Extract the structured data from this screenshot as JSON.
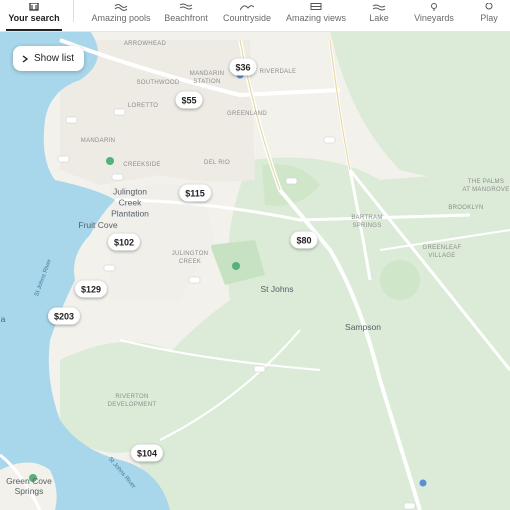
{
  "categories": [
    {
      "label": "Your search",
      "icon": "search-history-icon"
    },
    {
      "label": "Amazing pools",
      "icon": "pool-icon"
    },
    {
      "label": "Beachfront",
      "icon": "waves-icon"
    },
    {
      "label": "Countryside",
      "icon": "hills-icon"
    },
    {
      "label": "Amazing views",
      "icon": "view-icon"
    },
    {
      "label": "Lake",
      "icon": "lake-icon"
    },
    {
      "label": "Vineyards",
      "icon": "grape-icon"
    },
    {
      "label": "Play",
      "icon": "play-icon"
    }
  ],
  "show_list_label": "Show list",
  "price_pins": [
    "$36",
    "$55",
    "$115",
    "$80",
    "$102",
    "$129",
    "$203",
    "$104"
  ],
  "places": {
    "julington": "Julington\nCreek\nPlantation",
    "fruit_cove": "Fruit Cove",
    "st_johns": "St Johns",
    "sampson": "Sampson",
    "green_cove": "Green Cove\nSprings",
    "arrowhead": "ARROWHEAD",
    "southwood": "SOUTHWOOD",
    "loretto": "LORETTO",
    "mandarin_station": "MANDARIN\nSTATION",
    "mandarin": "MANDARIN",
    "creekside": "CREEKSIDE",
    "del_rio": "DEL RIO",
    "greenland": "GREENLAND",
    "bartram": "BARTRAM\nSPRINGS",
    "julington_creek": "JULINGTON\nCREEK",
    "riverdale": "RIVERDALE",
    "riverton": "RIVERTON\nDEVELOPMENT",
    "greenleaf": "GREENLEAF\nVILLAGE",
    "brooklyn": "BROOKLYN",
    "the_palms": "THE PALMS\nAT MANGROVE",
    "river_label": "St Johns River",
    "river_label_2": "St Johns River",
    "edge_letter": "a"
  }
}
